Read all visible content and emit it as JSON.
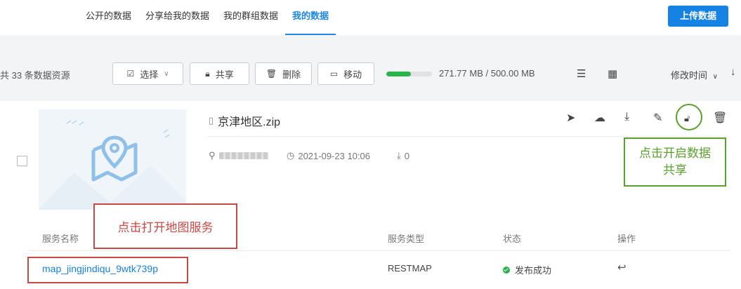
{
  "tabs": [
    {
      "label": "公开的数据"
    },
    {
      "label": "分享给我的数据"
    },
    {
      "label": "我的群组数据"
    },
    {
      "label": "我的数据",
      "active": true
    }
  ],
  "upload_button": "上传数据",
  "toolbar": {
    "count_text": "共 33 条数据资源",
    "select_label": "选择",
    "share_label": "共享",
    "delete_label": "删除",
    "move_label": "移动",
    "storage_text": "271.77 MB / 500.00 MB",
    "storage_used_fraction": 0.54,
    "sort_label": "修改时间"
  },
  "file": {
    "name": "京津地区.zip",
    "date": "2021-09-23 10:06",
    "downloads": "0"
  },
  "annotations": {
    "share_note_line1": "点击开启数据",
    "share_note_line2": "共享",
    "open_map_note": "点击打开地图服务"
  },
  "services_table": {
    "headers": {
      "name": "服务名称",
      "type": "服务类型",
      "status": "状态",
      "ops": "操作"
    },
    "rows": [
      {
        "name": "map_jingjindiqu_9wtk739p",
        "type": "RESTMAP",
        "status": "发布成功"
      }
    ]
  },
  "colors": {
    "accent": "#1683e4",
    "success": "#29b34a",
    "annotation_green": "#5aa02c",
    "annotation_red": "#c94843"
  }
}
